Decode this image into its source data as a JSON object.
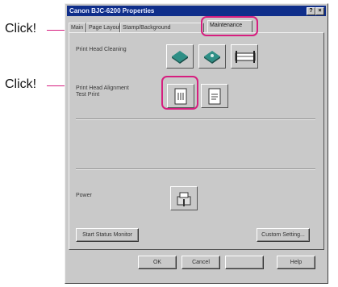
{
  "callouts": [
    "Click!",
    "Click!"
  ],
  "window": {
    "title": "Canon BJC-6200 Properties",
    "help_glyph": "?",
    "close_glyph": "×"
  },
  "tabs": [
    {
      "label": "Main"
    },
    {
      "label": "Page Layout"
    },
    {
      "label": "Stamp/Background"
    },
    {
      "label": "Maintenance",
      "active": true
    }
  ],
  "sections": {
    "print_head_cleaning": {
      "label": "Print Head Cleaning",
      "icons": [
        "cleaning-icon",
        "deep-cleaning-icon",
        "roller-cleaning-icon"
      ]
    },
    "print_head_alignment": {
      "label_line1": "Print Head Alignment",
      "label_line2": "Test Print",
      "icons": [
        "alignment-icon",
        "nozzle-check-icon"
      ]
    },
    "power": {
      "label": "Power",
      "icons": [
        "power-off-icon"
      ]
    }
  },
  "buttons": {
    "status_monitor": "Start Status Monitor",
    "custom_setting": "Custom Setting...",
    "ok": "OK",
    "cancel": "Cancel",
    "apply": "",
    "help": "Help"
  },
  "colors": {
    "highlight": "#d61e7f",
    "title_bar": "#0f2e8a",
    "dialog_face": "#c9c9c9",
    "icon_teal": "#2e8f86"
  }
}
